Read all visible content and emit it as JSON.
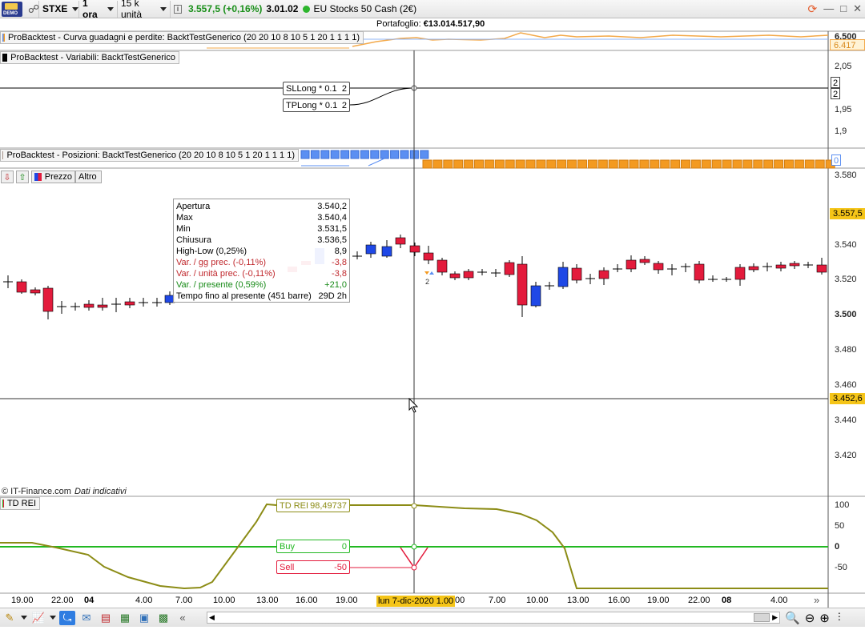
{
  "toolbar": {
    "logo_text": "DEMO",
    "instrument": "STXE",
    "timeframe": "1 ora",
    "units": "15 k unità",
    "info_icon": "i",
    "last_price": "3.557,5 (+0,16%)",
    "clock": "3.01.02",
    "market_name": "EU Stocks 50 Cash (2€)"
  },
  "portfolio": {
    "label": "Portafoglio:",
    "value": "€13.014.517,90"
  },
  "panels": {
    "equity_title": "ProBacktest - Curva guadagni e perdite: BacktTestGenerico (20 20 10 8 10 5 1 20 1 1 1 1)",
    "equity_axis_top": "6.500",
    "equity_tag": "6.417",
    "variables_title": "ProBacktest - Variabili: BacktTestGenerico",
    "variables_axis": [
      "2,05",
      "2",
      "1,95",
      "1,9"
    ],
    "variables_tags": [
      "2",
      "2"
    ],
    "sl_label": "SLLong * 0.1",
    "sl_value": "2",
    "tp_label": "TPLong * 0.1",
    "tp_value": "2",
    "positions_title": "ProBacktest - Posizioni: BacktTestGenerico (20 20 10 8 10 5 1 20 1 1 1 1)",
    "positions_tag": "0",
    "price_tab": "Prezzo",
    "other_tab": "Altro"
  },
  "price_axis": [
    "3.580",
    "3.540",
    "3.520",
    "3.500",
    "3.480",
    "3.460",
    "3.440",
    "3.420"
  ],
  "price_tags": {
    "current": "3.557,5",
    "cursor": "3.452,6"
  },
  "tooltip": [
    {
      "label": "Apertura",
      "value": "3.540,2",
      "color": "#000000"
    },
    {
      "label": "Max",
      "value": "3.540,4",
      "color": "#000000"
    },
    {
      "label": "Min",
      "value": "3.531,5",
      "color": "#000000"
    },
    {
      "label": "Chiusura",
      "value": "3.536,5",
      "color": "#000000"
    },
    {
      "label": "High-Low (0,25%)",
      "value": "8,9",
      "color": "#000000"
    },
    {
      "label": "Var. / gg prec. (-0,11%)",
      "value": "-3,8",
      "color": "#c0282d"
    },
    {
      "label": "Var. / unità prec. (-0,11%)",
      "value": "-3,8",
      "color": "#c0282d"
    },
    {
      "label": "Var. / presente (0,59%)",
      "value": "+21,0",
      "color": "#178a17"
    },
    {
      "label": "Tempo fino al presente (451 barre)",
      "value": "29D 2h",
      "color": "#000000"
    }
  ],
  "trade_marker_count": "2",
  "copyright": {
    "source": "© IT-Finance.com",
    "note": "Dati indicativi"
  },
  "indicator": {
    "title": "TD REI",
    "rei_label": "TD REI",
    "rei_value": "98,49737",
    "buy_label": "Buy",
    "buy_value": "0",
    "sell_label": "Sell",
    "sell_value": "-50",
    "axis": [
      "100",
      "50",
      "0",
      "-50"
    ]
  },
  "time_axis": [
    "19.00",
    "22.00",
    "04",
    "4.00",
    "7.00",
    "10.00",
    "13.00",
    "16.00",
    "19.00",
    "00",
    "7.00",
    "10.00",
    "13.00",
    "16.00",
    "19.00",
    "22.00",
    "08",
    "4.00"
  ],
  "time_cursor_label": "lun 7-dic-2020 1.00",
  "colors": {
    "bull": "#1f48e6",
    "bear": "#e31b3c",
    "rei_line": "#8c8c16",
    "zero_line": "#22b822",
    "sell_line": "#e31b3c",
    "position": "#f39a21",
    "position_past": "#5b8ff2",
    "price_tag_bg": "#f5c518",
    "cursor_tag_bg": "#f5c518"
  }
}
